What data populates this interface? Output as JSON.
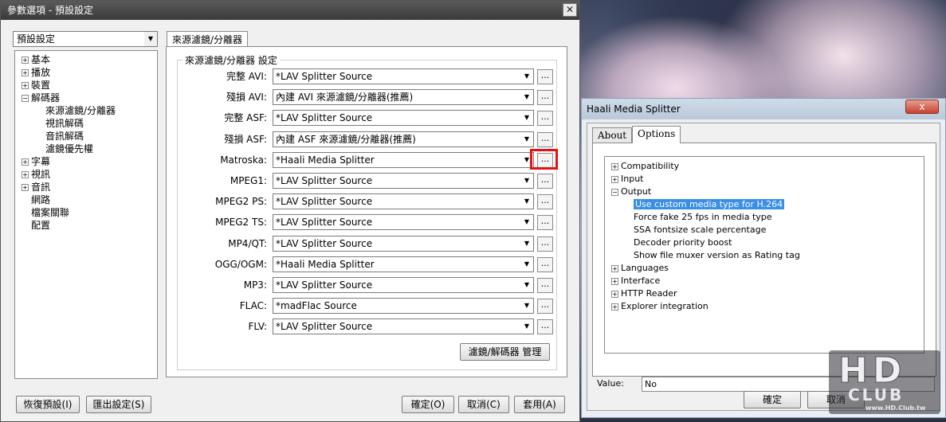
{
  "prefs": {
    "title": "參數選項 - 預設設定",
    "close": "✕",
    "preset": "預設設定",
    "tree": [
      {
        "label": "基本",
        "expander": "+",
        "indent": 0
      },
      {
        "label": "播放",
        "expander": "+",
        "indent": 0
      },
      {
        "label": "裝置",
        "expander": "+",
        "indent": 0
      },
      {
        "label": "解碼器",
        "expander": "−",
        "indent": 0
      },
      {
        "label": "來源濾鏡/分離器",
        "expander": "",
        "indent": 1
      },
      {
        "label": "視訊解碼",
        "expander": "",
        "indent": 1
      },
      {
        "label": "音訊解碼",
        "expander": "",
        "indent": 1
      },
      {
        "label": "濾鏡優先權",
        "expander": "",
        "indent": 1
      },
      {
        "label": "字幕",
        "expander": "+",
        "indent": 0
      },
      {
        "label": "視訊",
        "expander": "+",
        "indent": 0
      },
      {
        "label": "音訊",
        "expander": "+",
        "indent": 0
      },
      {
        "label": "網路",
        "expander": "",
        "indent": 0
      },
      {
        "label": "檔案關聯",
        "expander": "",
        "indent": 0
      },
      {
        "label": "配置",
        "expander": "",
        "indent": 0
      }
    ],
    "tab": "來源濾鏡/分離器",
    "group_title": "來源濾鏡/分離器 設定",
    "rows": [
      {
        "label": "完整 AVI:",
        "value": "*LAV Splitter Source"
      },
      {
        "label": "殘損 AVI:",
        "value": "內建 AVI 來源濾鏡/分離器(推薦)"
      },
      {
        "label": "完整 ASF:",
        "value": "*LAV Splitter Source"
      },
      {
        "label": "殘損 ASF:",
        "value": "內建 ASF 來源濾鏡/分離器(推薦)"
      },
      {
        "label": "Matroska:",
        "value": "*Haali Media Splitter"
      },
      {
        "label": "MPEG1:",
        "value": "*LAV Splitter Source"
      },
      {
        "label": "MPEG2 PS:",
        "value": "*LAV Splitter Source"
      },
      {
        "label": "MPEG2 TS:",
        "value": "*LAV Splitter Source"
      },
      {
        "label": "MP4/QT:",
        "value": "*LAV Splitter Source"
      },
      {
        "label": "OGG/OGM:",
        "value": "*Haali Media Splitter"
      },
      {
        "label": "MP3:",
        "value": "*LAV Splitter Source"
      },
      {
        "label": "FLAC:",
        "value": "*madFlac Source"
      },
      {
        "label": "FLV:",
        "value": "*LAV Splitter Source"
      }
    ],
    "dots": "...",
    "manage": "濾鏡/解碼器 管理",
    "restore": "恢復預設(I)",
    "export": "匯出設定(S)",
    "ok": "確定(O)",
    "cancel": "取消(C)",
    "apply": "套用(A)"
  },
  "haali": {
    "title": "Haali Media Splitter",
    "close": "x",
    "tab_about": "About",
    "tab_options": "Options",
    "tree": [
      {
        "label": "Compatibility",
        "expander": "+",
        "indent": 0
      },
      {
        "label": "Input",
        "expander": "+",
        "indent": 0
      },
      {
        "label": "Output",
        "expander": "−",
        "indent": 0
      },
      {
        "label": "Use custom media type for H.264",
        "expander": "",
        "indent": 1,
        "selected": true
      },
      {
        "label": "Force fake 25 fps in media type",
        "expander": "",
        "indent": 1
      },
      {
        "label": "SSA fontsize scale percentage",
        "expander": "",
        "indent": 1
      },
      {
        "label": "Decoder priority boost",
        "expander": "",
        "indent": 1
      },
      {
        "label": "Show file muxer version as Rating tag",
        "expander": "",
        "indent": 1
      },
      {
        "label": "Languages",
        "expander": "+",
        "indent": 0
      },
      {
        "label": "Interface",
        "expander": "+",
        "indent": 0
      },
      {
        "label": "HTTP Reader",
        "expander": "+",
        "indent": 0
      },
      {
        "label": "Explorer integration",
        "expander": "+",
        "indent": 0
      }
    ],
    "value_label": "Value:",
    "value": "No",
    "ok": "確定",
    "cancel": "取消"
  },
  "watermark": {
    "hd": "HD",
    "club": "CLUB",
    "url": "www.HD.Club.tw"
  }
}
